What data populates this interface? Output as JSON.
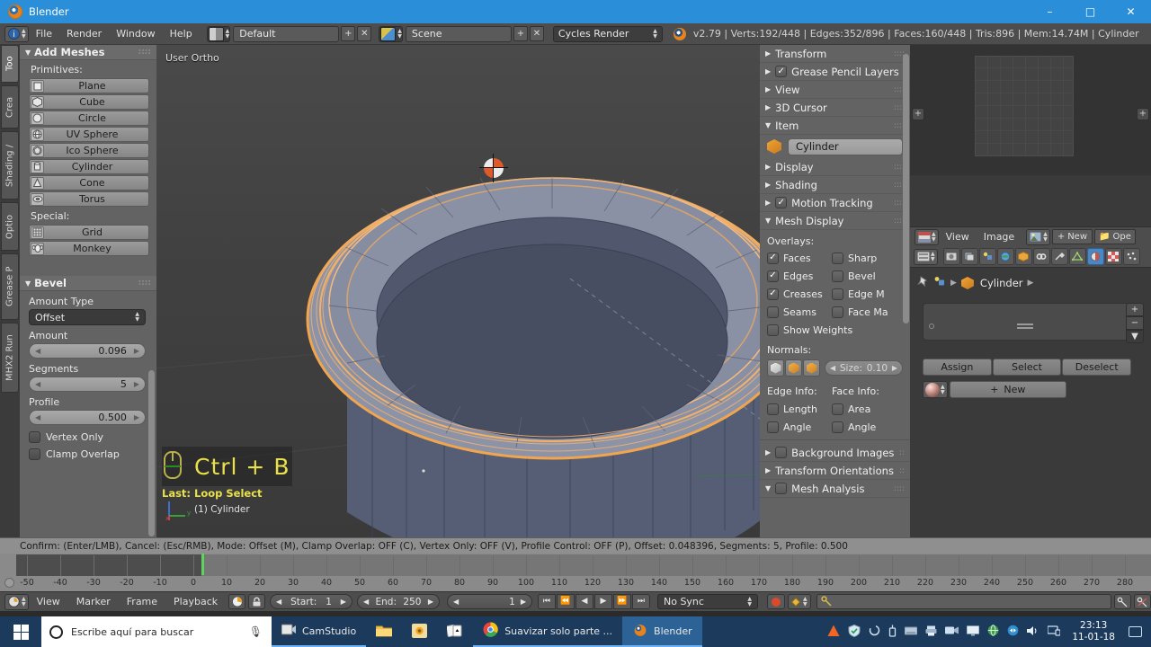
{
  "window": {
    "title": "Blender",
    "icon": "blender-logo-icon",
    "minimize": "–",
    "maximize": "□",
    "close": "✕"
  },
  "topbar": {
    "editor_icon": "info-editor-icon",
    "menus": [
      "File",
      "Render",
      "Window",
      "Help"
    ],
    "screen_layout": "Default",
    "scene_name": "Scene",
    "engine": "Cycles Render",
    "add_label": "+",
    "remove_label": "✕",
    "stats": "v2.79 | Verts:192/448 | Edges:352/896 | Faces:160/448 | Tris:896 | Mem:14.74M | Cylinder"
  },
  "tool_tabs": [
    {
      "label": "Too",
      "active": true
    },
    {
      "label": "Crea",
      "active": false
    },
    {
      "label": "Shading /",
      "active": false
    },
    {
      "label": "Optio",
      "active": false
    },
    {
      "label": "Grease P",
      "active": false
    },
    {
      "label": "MHX2 Run",
      "active": false
    }
  ],
  "add_meshes": {
    "title": "Add Meshes",
    "primitives_label": "Primitives:",
    "primitives": [
      {
        "label": "Plane",
        "icon": "plane-icon"
      },
      {
        "label": "Cube",
        "icon": "cube-icon"
      },
      {
        "label": "Circle",
        "icon": "circle-icon"
      },
      {
        "label": "UV Sphere",
        "icon": "uv-sphere-icon"
      },
      {
        "label": "Ico Sphere",
        "icon": "ico-sphere-icon"
      },
      {
        "label": "Cylinder",
        "icon": "cylinder-icon"
      },
      {
        "label": "Cone",
        "icon": "cone-icon"
      },
      {
        "label": "Torus",
        "icon": "torus-icon"
      }
    ],
    "special_label": "Special:",
    "special": [
      {
        "label": "Grid",
        "icon": "grid-icon"
      },
      {
        "label": "Monkey",
        "icon": "monkey-icon"
      }
    ]
  },
  "bevel": {
    "title": "Bevel",
    "amount_type_label": "Amount Type",
    "amount_type_value": "Offset",
    "amount_label": "Amount",
    "amount_value": "0.096",
    "segments_label": "Segments",
    "segments_value": "5",
    "profile_label": "Profile",
    "profile_value": "0.500",
    "vertex_only_label": "Vertex Only",
    "vertex_only_checked": false,
    "clamp_overlap_label": "Clamp Overlap",
    "clamp_overlap_checked": false
  },
  "viewport": {
    "view_label": "User Ortho",
    "shortcut_overlay": "Ctrl + B",
    "last_operator": "Last: Loop Select",
    "object_count": "(1) Cylinder"
  },
  "npanel": {
    "sections": [
      {
        "label": "Transform",
        "open": false,
        "checkbox": null
      },
      {
        "label": "Grease Pencil Layers",
        "open": false,
        "checkbox": true
      },
      {
        "label": "View",
        "open": false,
        "checkbox": null
      },
      {
        "label": "3D Cursor",
        "open": false,
        "checkbox": null
      },
      {
        "label": "Item",
        "open": true,
        "checkbox": null
      }
    ],
    "item_object_name": "Cylinder",
    "sections2": [
      {
        "label": "Display",
        "open": false,
        "checkbox": null
      },
      {
        "label": "Shading",
        "open": false,
        "checkbox": null
      },
      {
        "label": "Motion Tracking",
        "open": false,
        "checkbox": true
      },
      {
        "label": "Mesh Display",
        "open": true,
        "checkbox": null
      }
    ],
    "overlays_label": "Overlays:",
    "overlays": [
      {
        "label": "Faces",
        "checked": true
      },
      {
        "label": "Sharp",
        "checked": false
      },
      {
        "label": "Edges",
        "checked": true
      },
      {
        "label": "Bevel",
        "checked": false
      },
      {
        "label": "Creases",
        "checked": true
      },
      {
        "label": "Edge M",
        "checked": false
      },
      {
        "label": "Seams",
        "checked": false
      },
      {
        "label": "Face Ma",
        "checked": false
      }
    ],
    "show_weights_label": "Show Weights",
    "show_weights_checked": false,
    "normals_label": "Normals:",
    "normals_size_label": "Size:",
    "normals_size_value": "0.10",
    "edge_info_label": "Edge Info:",
    "face_info_label": "Face Info:",
    "edge_info": [
      {
        "label": "Length",
        "checked": false
      },
      {
        "label": "Angle",
        "checked": false
      }
    ],
    "face_info": [
      {
        "label": "Area",
        "checked": false
      },
      {
        "label": "Angle",
        "checked": false
      }
    ],
    "sections3": [
      {
        "label": "Background Images",
        "open": false,
        "checkbox": false
      },
      {
        "label": "Transform Orientations",
        "open": false,
        "checkbox": null
      },
      {
        "label": "Mesh Analysis",
        "open": true,
        "checkbox": false
      }
    ]
  },
  "properties": {
    "image_header": {
      "editor_icon": "uv-image-editor-icon",
      "menus": [
        "View",
        "Image"
      ],
      "image_mode_icon": "image-icon",
      "new_label": "New",
      "open_label": "Ope"
    },
    "tab_icons": [
      "render-icon",
      "render-layers-icon",
      "scene-icon",
      "world-icon",
      "object-icon",
      "constraints-icon",
      "modifiers-icon",
      "data-icon",
      "material-icon",
      "texture-icon",
      "particles-icon"
    ],
    "active_tab": "material-icon",
    "breadcrumb_object": "Cylinder",
    "breadcrumb_pin_icon": "pin-icon",
    "material_buttons": [
      "Assign",
      "Select",
      "Deselect"
    ],
    "new_material_label": "New",
    "list_add": "+",
    "list_remove": "−",
    "list_menu": "▼"
  },
  "report_bar": {
    "text": "Confirm: (Enter/LMB), Cancel: (Esc/RMB), Mode: Offset (M), Clamp Overlap: OFF (C), Vertex Only: OFF (V), Profile Control: OFF (P), Offset: 0.048396, Segments: 5, Profile: 0.500"
  },
  "timeline": {
    "ticks": [
      -50,
      -40,
      -30,
      -20,
      -10,
      0,
      10,
      20,
      30,
      40,
      50,
      60,
      70,
      80,
      90,
      100,
      110,
      120,
      130,
      140,
      150,
      160,
      170,
      180,
      190,
      200,
      210,
      220,
      230,
      240,
      250,
      260,
      270,
      280
    ],
    "current_frame": 1,
    "editor_icon": "timeline-editor-icon",
    "menus": [
      "View",
      "Marker",
      "Frame",
      "Playback"
    ],
    "start_label": "Start:",
    "start_value": "1",
    "end_label": "End:",
    "end_value": "250",
    "frame_value": "1",
    "sync_mode": "No Sync",
    "transport": [
      "jump-start-icon",
      "prev-keyframe-icon",
      "play-reverse-icon",
      "play-icon",
      "next-keyframe-icon",
      "jump-end-icon"
    ],
    "record_icon": "record-icon",
    "keying_set_icon": "keying-set-icon"
  },
  "taskbar": {
    "start_icon": "windows-start-icon",
    "search_placeholder": "Escribe aquí para buscar",
    "cortana_icon": "cortana-icon",
    "mic_icon": "microphone-icon",
    "items": [
      {
        "label": "CamStudio",
        "icon": "camstudio-icon",
        "active": false,
        "open": true
      },
      {
        "label": "",
        "icon": "file-explorer-icon",
        "active": false,
        "open": false
      },
      {
        "label": "",
        "icon": "photos-icon",
        "active": false,
        "open": false
      },
      {
        "label": "",
        "icon": "solitaire-icon",
        "active": false,
        "open": false
      },
      {
        "label": "Suavizar solo parte ...",
        "icon": "chrome-icon",
        "active": false,
        "open": true
      },
      {
        "label": "Blender",
        "icon": "blender-icon",
        "active": true,
        "open": true
      }
    ],
    "tray_icons": [
      "avast-icon",
      "defender-icon",
      "sync-icon",
      "usb-icon",
      "disk-icon",
      "printer-icon",
      "camera-icon",
      "monitor-icon",
      "network-icon",
      "teamviewer-icon",
      "volume-icon",
      "display-icon"
    ],
    "clock_time": "23:13",
    "clock_date": "11-01-18",
    "notification_icon": "notifications-icon"
  },
  "colors": {
    "title_blue": "#2a8fd8",
    "panel_gray": "#636363",
    "header_gray": "#4d4d4d",
    "viewport_bg": "#3f3f3f",
    "accent_orange": "#e8821c",
    "selection_orange": "#f2a34a",
    "highlight_blue": "#4b87c7",
    "overlay_yellow": "#e9e14a",
    "playhead_green": "#5fd35f",
    "taskbar_blue": "#1b3a5c"
  }
}
